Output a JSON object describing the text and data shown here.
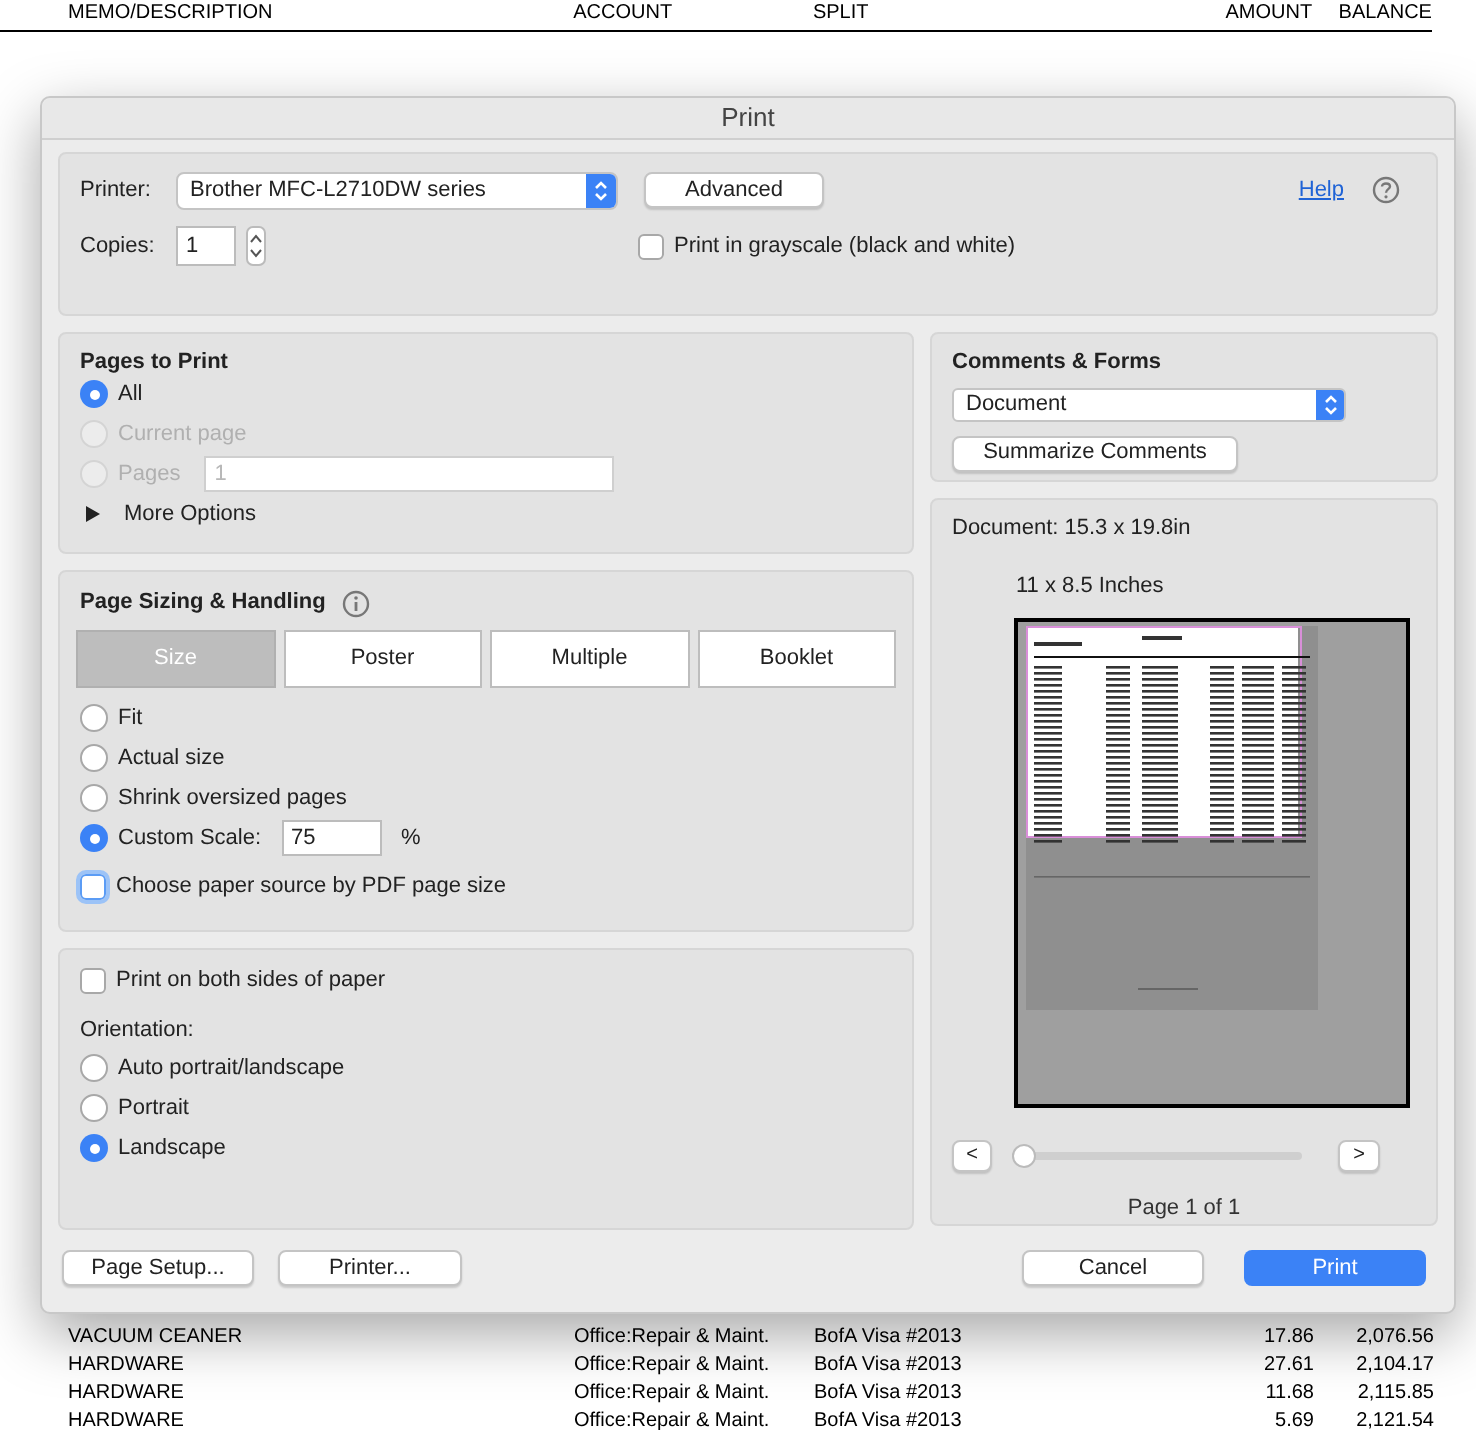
{
  "report": {
    "columns": [
      "MEMO/DESCRIPTION",
      "ACCOUNT",
      "SPLIT",
      "AMOUNT",
      "BALANCE"
    ],
    "rows_below": [
      {
        "cells": [
          "VACUUM CEANER",
          "Office:Repair & Maint.",
          "BofA  Visa #2013",
          "17.86",
          "2,076.56"
        ]
      },
      {
        "cells": [
          "HARDWARE",
          "Office:Repair & Maint.",
          "BofA  Visa #2013",
          "27.61",
          "2,104.17"
        ]
      },
      {
        "cells": [
          "HARDWARE",
          "Office:Repair & Maint.",
          "BofA  Visa #2013",
          "11.68",
          "2,115.85"
        ]
      },
      {
        "cells": [
          "HARDWARE",
          "Office:Repair & Maint.",
          "BofA  Visa #2013",
          "5.69",
          "2,121.54"
        ]
      }
    ]
  },
  "dialog": {
    "title": "Print",
    "printer": {
      "label": "Printer:",
      "value": "Brother MFC-L2710DW series"
    },
    "advanced": "Advanced",
    "help": "Help",
    "copies": {
      "label": "Copies:",
      "value": "1"
    },
    "grayscale": {
      "label": "Print in grayscale (black and white)",
      "checked": false
    },
    "pages_to_print": {
      "title": "Pages to Print",
      "options": [
        {
          "label": "All",
          "selected": true,
          "disabled": false
        },
        {
          "label": "Current page",
          "selected": false,
          "disabled": true
        },
        {
          "label": "Pages",
          "selected": false,
          "disabled": true
        }
      ],
      "pages_value": "1",
      "more_options": "More Options"
    },
    "page_sizing": {
      "title": "Page Sizing & Handling",
      "tabs": [
        {
          "label": "Size",
          "selected": true
        },
        {
          "label": "Poster",
          "selected": false
        },
        {
          "label": "Multiple",
          "selected": false
        },
        {
          "label": "Booklet",
          "selected": false
        }
      ],
      "options": [
        {
          "label": "Fit",
          "selected": false
        },
        {
          "label": "Actual size",
          "selected": false
        },
        {
          "label": "Shrink oversized pages",
          "selected": false
        },
        {
          "label": "Custom Scale:",
          "selected": true
        }
      ],
      "scale_value": "75",
      "percent": "%",
      "paper_source": {
        "label": "Choose paper source by PDF page size",
        "checked": false
      }
    },
    "duplex": {
      "label": "Print on both sides of paper",
      "checked": false
    },
    "orientation": {
      "label": "Orientation:",
      "options": [
        {
          "label": "Auto portrait/landscape",
          "selected": false
        },
        {
          "label": "Portrait",
          "selected": false
        },
        {
          "label": "Landscape",
          "selected": true
        }
      ]
    },
    "comments_forms": {
      "title": "Comments & Forms",
      "value": "Document",
      "button": "Summarize Comments"
    },
    "preview": {
      "document": "Document: 15.3 x 19.8in",
      "paper": "11 x 8.5 Inches",
      "prev": "<",
      "next": ">",
      "level": 0,
      "page_indicator": "Page 1 of 1"
    },
    "buttons": {
      "page_setup": "Page Setup...",
      "printer": "Printer...",
      "cancel": "Cancel",
      "print": "Print"
    }
  }
}
